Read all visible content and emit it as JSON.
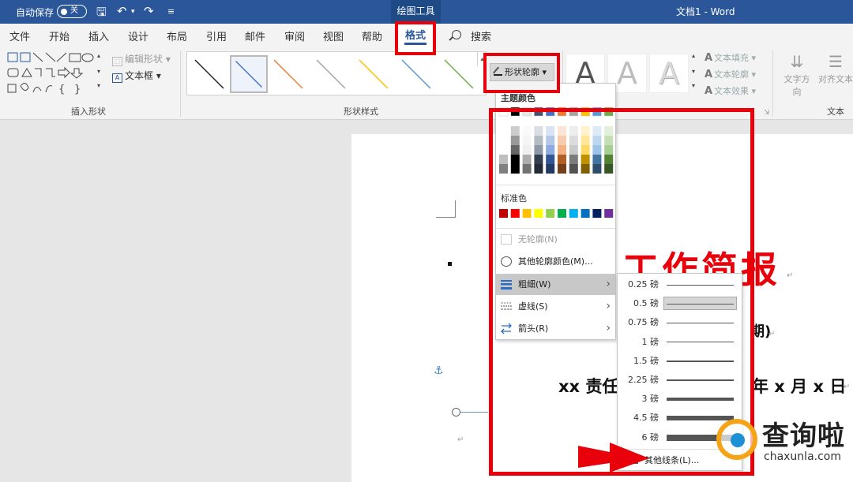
{
  "titlebar": {
    "autosave_label": "自动保存",
    "autosave_state": "关",
    "context_tab": "绘图工具",
    "doc_title": "文档1  -  Word"
  },
  "tabs": [
    "文件",
    "开始",
    "插入",
    "设计",
    "布局",
    "引用",
    "邮件",
    "审阅",
    "视图",
    "帮助"
  ],
  "active_tab": "格式",
  "search_label": "搜索",
  "ribbon": {
    "insert_shapes": {
      "label": "插入形状",
      "edit_shape": "编辑形状",
      "text_box": "文本框"
    },
    "shape_styles": {
      "label": "形状样式",
      "swatch_colors": [
        "#222222",
        "#4472c4",
        "#ed7d31",
        "#a5a5a5",
        "#ffc000",
        "#5b9bd5",
        "#70ad47"
      ],
      "shape_outline": "形状轮廓"
    },
    "wordart": {
      "letter": "A",
      "text_fill": "文本填充",
      "text_outline": "文本轮廓",
      "text_effects": "文本效果"
    },
    "text": {
      "label": "文本",
      "text_direction": "文字方向",
      "align_text": "对齐文本"
    }
  },
  "outline_menu": {
    "theme_colors_header": "主题颜色",
    "standard_colors_header": "标准色",
    "theme_top_row": [
      "#ffffff",
      "#000000",
      "#e7e6e6",
      "#44546a",
      "#4472c4",
      "#ed7d31",
      "#a5a5a5",
      "#ffc000",
      "#5b9bd5",
      "#70ad47"
    ],
    "standard_colors": [
      "#c00000",
      "#ff0000",
      "#ffc000",
      "#ffff00",
      "#92d050",
      "#00b050",
      "#00b0f0",
      "#0070c0",
      "#002060",
      "#7030a0"
    ],
    "no_outline": "无轮廓(N)",
    "more_colors": "其他轮廓颜色(M)...",
    "weight": "粗细(W)",
    "dashes": "虚线(S)",
    "arrows": "箭头(R)"
  },
  "weight_menu": {
    "items": [
      {
        "label": "0.25 磅",
        "pt": 0.25
      },
      {
        "label": "0.5 磅",
        "pt": 0.5,
        "selected": true
      },
      {
        "label": "0.75 磅",
        "pt": 0.75
      },
      {
        "label": "1 磅",
        "pt": 1
      },
      {
        "label": "1.5 磅",
        "pt": 1.5
      },
      {
        "label": "2.25 磅",
        "pt": 2.25
      },
      {
        "label": "3 磅",
        "pt": 3
      },
      {
        "label": "4.5 磅",
        "pt": 4.5
      },
      {
        "label": "6 磅",
        "pt": 6
      }
    ],
    "more_lines": "其他线条(L)..."
  },
  "document": {
    "title": "工作简报",
    "line2_fragment": "期)",
    "line3_left": "xx 责任",
    "line3_right": "年 x 月 x 日"
  },
  "watermark": {
    "text": "查询啦",
    "url": "chaxunla.com"
  }
}
